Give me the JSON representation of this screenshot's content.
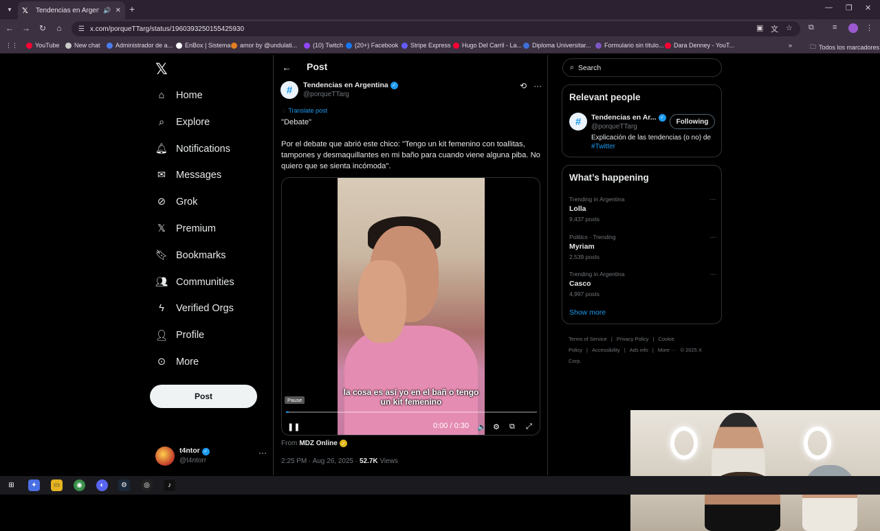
{
  "browser": {
    "tab_title": "Tendencias en Argentina c",
    "url": "x.com/porqueTTarg/status/1960393250155425930",
    "bookmarks": [
      {
        "label": "YouTube",
        "color": "#ff0033"
      },
      {
        "label": "New chat",
        "color": "#cccccc"
      },
      {
        "label": "Administrador de a...",
        "color": "#4b7bec"
      },
      {
        "label": "EnBox | Sistema",
        "color": "#ffffff"
      },
      {
        "label": "amor by @undulati...",
        "color": "#e67e22"
      },
      {
        "label": "(10) Twitch",
        "color": "#9146ff"
      },
      {
        "label": "(20+) Facebook",
        "color": "#1877f2"
      },
      {
        "label": "Stripe Express",
        "color": "#635bff"
      },
      {
        "label": "Hugo Del Carril - La...",
        "color": "#ff0033"
      },
      {
        "label": "Diploma Universitar...",
        "color": "#3f6fd8"
      },
      {
        "label": "Formulario sin título...",
        "color": "#7e57c2"
      },
      {
        "label": "Dara Denney - YouT...",
        "color": "#ff0033"
      }
    ],
    "bookmarks_folder": "Todos los marcadores"
  },
  "nav": {
    "items": [
      {
        "label": "Home",
        "icon": "home-icon"
      },
      {
        "label": "Explore",
        "icon": "search-icon"
      },
      {
        "label": "Notifications",
        "icon": "bell-icon"
      },
      {
        "label": "Messages",
        "icon": "mail-icon"
      },
      {
        "label": "Grok",
        "icon": "grok-icon"
      },
      {
        "label": "Premium",
        "icon": "x-icon"
      },
      {
        "label": "Bookmarks",
        "icon": "bookmark-icon"
      },
      {
        "label": "Communities",
        "icon": "people-icon"
      },
      {
        "label": "Verified Orgs",
        "icon": "lightning-icon"
      },
      {
        "label": "Profile",
        "icon": "person-icon"
      },
      {
        "label": "More",
        "icon": "more-circle-icon"
      }
    ],
    "post_button": "Post",
    "account": {
      "name": "t4ntor",
      "handle": "@t4ntorr"
    }
  },
  "post": {
    "header": "Post",
    "author_name": "Tendencias en Argentina",
    "author_handle": "@porqueTTarg",
    "avatar_symbol": "#",
    "translate": "Translate post",
    "text": "\"Debate\"\n\nPor el debate que abrió este chico: \"Tengo un kit femenino con toallitas, tampones y desmaquillantes en mi baño para cuando viene alguna piba. No quiero que se sienta incómoda\".",
    "video": {
      "caption": "la cosa es así yo en el bañ o tengo un kit femenino",
      "tooltip": "Pause",
      "time": "0:00 / 0:30",
      "progress": 0.01
    },
    "from_label": "From",
    "from_account": "MDZ Online",
    "timestamp": "2:25 PM · Aug 26, 2025 · ",
    "views_count": "52.7K",
    "views_label": "Views"
  },
  "sidebar_right": {
    "search_placeholder": "Search",
    "relevant_title": "Relevant people",
    "relevant_person": {
      "name": "Tendencias en Ar...",
      "handle": "@porqueTTarg",
      "follow_label": "Following",
      "bio": "Explicación de las tendencias (o no) de ",
      "bio_link": "#Twitter"
    },
    "happening_title": "What’s happening",
    "trends": [
      {
        "context": "Trending in Argentina",
        "name": "Lolla",
        "count": "9,437 posts"
      },
      {
        "context": "Politics · Trending",
        "name": "Myriam",
        "count": "2,539 posts"
      },
      {
        "context": "Trending in Argentina",
        "name": "Casco",
        "count": "4,997 posts"
      }
    ],
    "show_more": "Show more",
    "footer": [
      "Terms of Service",
      "|",
      "Privacy Policy",
      "|",
      "Cookie Policy",
      "|",
      "Accessibility",
      "|",
      "Ads info",
      "|",
      "More ···",
      "© 2025 X Corp."
    ]
  }
}
